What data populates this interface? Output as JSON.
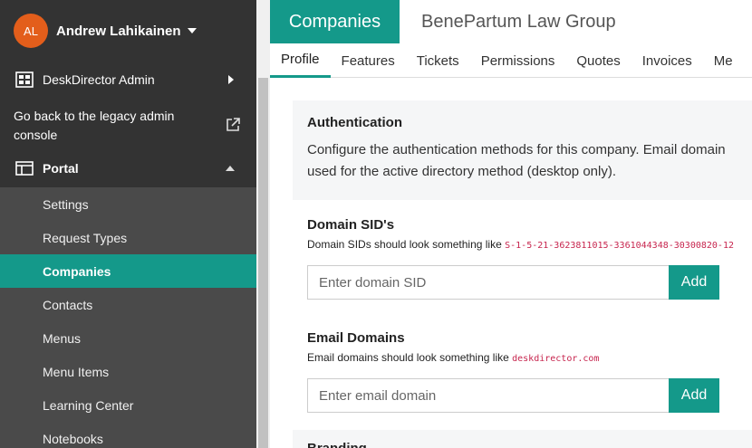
{
  "user": {
    "initials": "AL",
    "name": "Andrew Lahikainen",
    "avatar_color": "#e35e1b"
  },
  "nav": {
    "admin_label": "DeskDirector Admin",
    "legacy_label": "Go back to the legacy admin console",
    "portal_label": "Portal",
    "portal_items": [
      {
        "label": "Settings"
      },
      {
        "label": "Request Types"
      },
      {
        "label": "Companies"
      },
      {
        "label": "Contacts"
      },
      {
        "label": "Menus"
      },
      {
        "label": "Menu Items"
      },
      {
        "label": "Learning Center"
      },
      {
        "label": "Notebooks"
      }
    ],
    "active_item": "Companies"
  },
  "header": {
    "section_title": "Companies",
    "company_name": "BenePartum Law Group"
  },
  "tabs": [
    "Profile",
    "Features",
    "Tickets",
    "Permissions",
    "Quotes",
    "Invoices",
    "Me"
  ],
  "active_tab": "Profile",
  "authentication": {
    "heading": "Authentication",
    "description_line1": "Configure the authentication methods for this company. Email domain",
    "description_line2": "used for the active directory method (desktop only)."
  },
  "domain_sids": {
    "heading": "Domain SID's",
    "hint_prefix": "Domain SIDs should look something like",
    "hint_example": "S-1-5-21-3623811015-3361044348-30300820-12",
    "placeholder": "Enter domain SID",
    "button_label": "Add"
  },
  "email_domains": {
    "heading": "Email Domains",
    "hint_prefix": "Email domains should look something like",
    "hint_example": "deskdirector.com",
    "placeholder": "Enter email domain",
    "button_label": "Add"
  },
  "next_section": {
    "heading": "Branding"
  },
  "colors": {
    "accent": "#14998a",
    "sidebar": "#333333",
    "subnav": "#4a4a4a",
    "code": "#c7254e"
  }
}
